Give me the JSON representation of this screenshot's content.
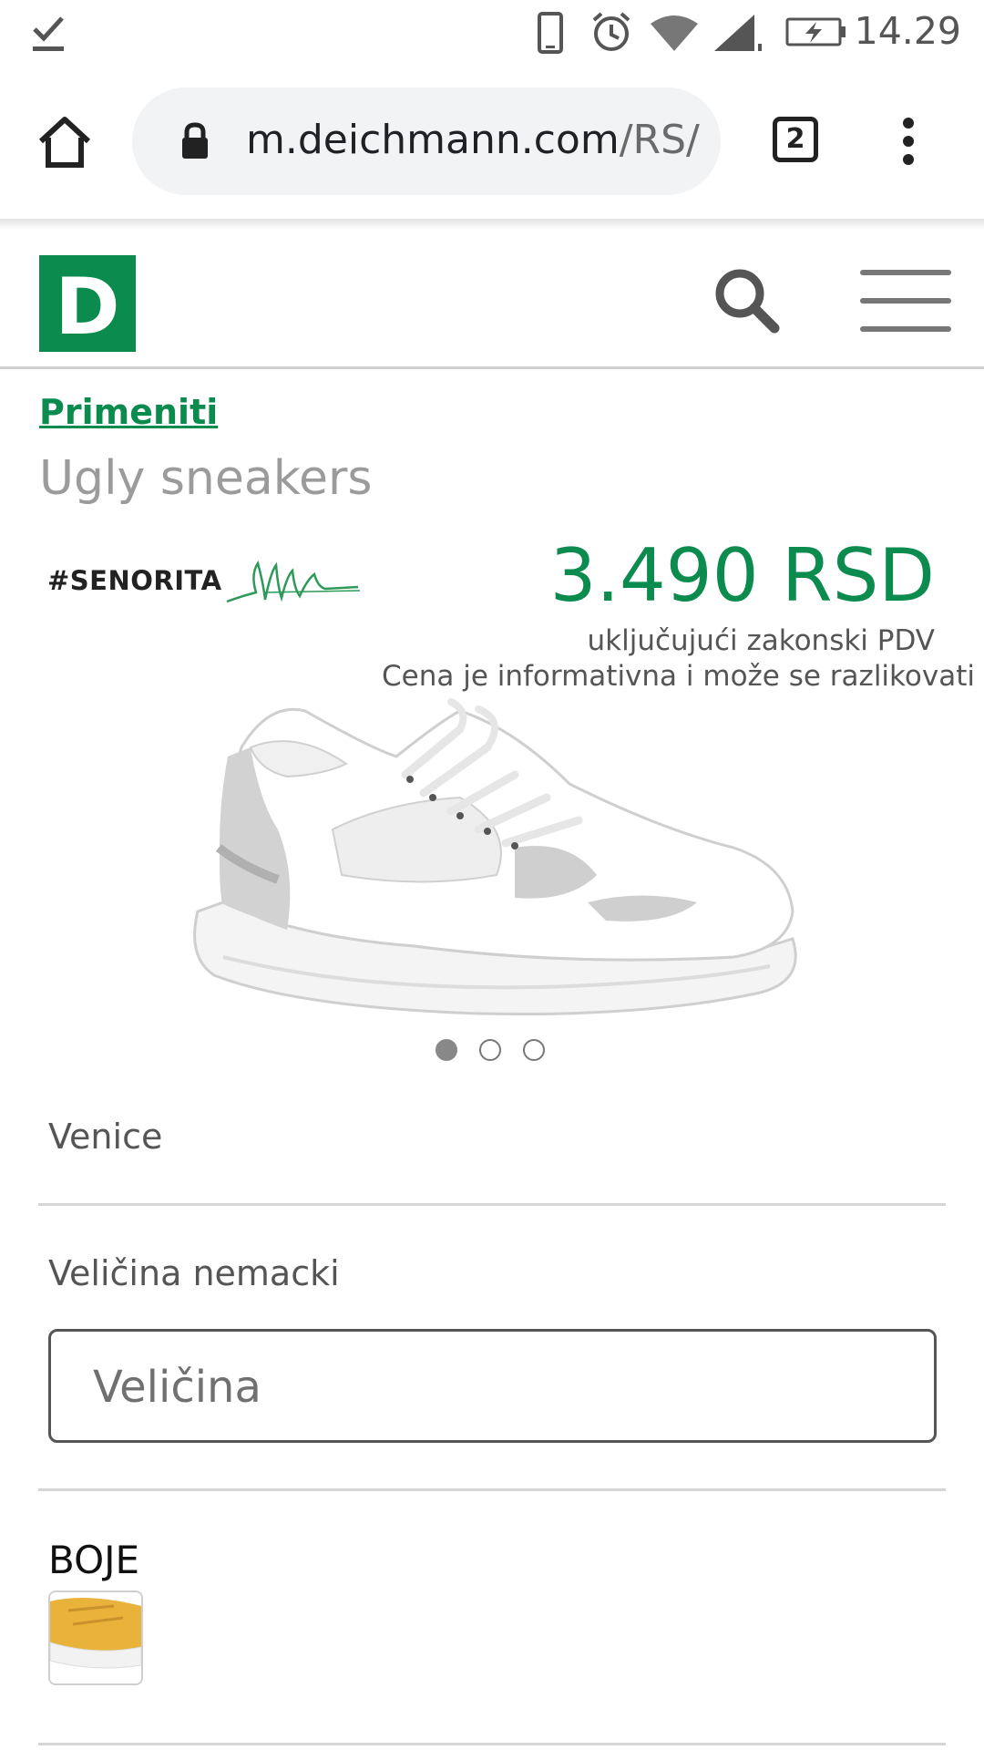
{
  "status_bar": {
    "time": "14.29",
    "icons": [
      "download-done-icon",
      "phone-icon",
      "alarm-icon",
      "wifi-icon",
      "signal-icon",
      "battery-charging-icon"
    ]
  },
  "browser": {
    "url_main": "m.deichmann.com",
    "url_rest": "/RS/",
    "tab_count": "2",
    "icons": [
      "home-icon",
      "lock-icon",
      "tab-switcher-icon",
      "more-menu-icon"
    ]
  },
  "header": {
    "logo_letter": "D",
    "icons": [
      "search-icon",
      "hamburger-menu-icon"
    ],
    "brand_color": "#0c8b4e"
  },
  "product": {
    "breadcrumb": "Primeniti",
    "category": "Ugly sneakers",
    "brand": "#SENORITA",
    "price": "3.490 RSD",
    "vat_note": "uključujući zakonski PDV",
    "disclaimer": "Cena je informativna i može se razlikovati od",
    "gallery": {
      "images": 3,
      "active_index": 0
    },
    "model_name": "Venice",
    "size_label": "Veličina nemacki",
    "size_placeholder": "Veličina",
    "colors_label": "BOJE",
    "color_swatches": [
      "yellow"
    ]
  }
}
